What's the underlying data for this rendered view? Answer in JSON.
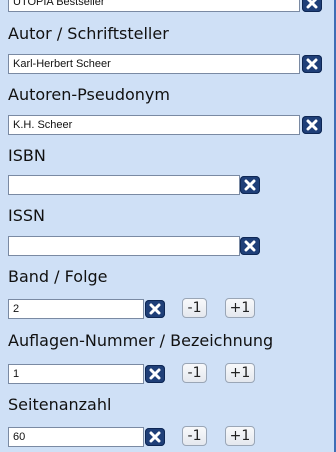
{
  "series": {
    "value": "UTOPIA Bestseller"
  },
  "author": {
    "label": "Autor / Schriftsteller",
    "value": "Karl-Herbert Scheer"
  },
  "pseudonym": {
    "label": "Autoren-Pseudonym",
    "value": "K.H. Scheer"
  },
  "isbn": {
    "label": "ISBN",
    "value": ""
  },
  "issn": {
    "label": "ISSN",
    "value": ""
  },
  "volume": {
    "label": "Band / Folge",
    "value": "2"
  },
  "edition": {
    "label": "Auflagen-Nummer / Bezeichnung",
    "value": "1"
  },
  "pages": {
    "label": "Seitenanzahl",
    "value": "60"
  },
  "buttons": {
    "minus": "-1",
    "plus": "+1",
    "clear_icon": "close-icon"
  },
  "colors": {
    "background": "#cfe0f6",
    "clear_button": "#1f3f78"
  }
}
